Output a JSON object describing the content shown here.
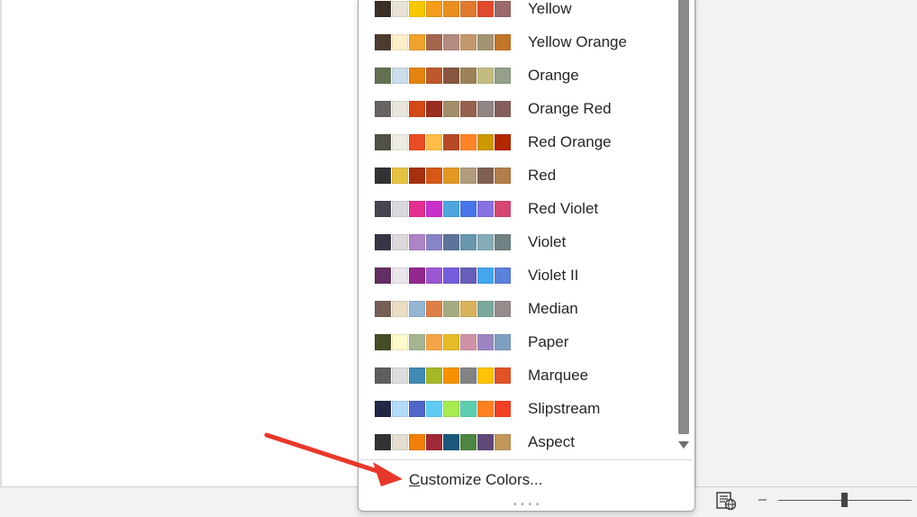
{
  "themes": [
    {
      "name": "Yellow",
      "colors": [
        "#3b2f28",
        "#e8e2d6",
        "#f7c700",
        "#f59c1a",
        "#ea8e20",
        "#e07a2e",
        "#e04a2e",
        "#9a6a6a"
      ]
    },
    {
      "name": "Yellow Orange",
      "colors": [
        "#4e3b30",
        "#fbeec9",
        "#f0a22e",
        "#a5644e",
        "#b58b80",
        "#c3986d",
        "#a19574",
        "#c17529"
      ]
    },
    {
      "name": "Orange",
      "colors": [
        "#637052",
        "#ccddea",
        "#e48312",
        "#bd582c",
        "#865640",
        "#9b8357",
        "#c2bc80",
        "#94a088"
      ]
    },
    {
      "name": "Orange Red",
      "colors": [
        "#696464",
        "#e9e5dc",
        "#d34817",
        "#9b2d1f",
        "#a28e6a",
        "#956251",
        "#918485",
        "#855d5d"
      ]
    },
    {
      "name": "Red Orange",
      "colors": [
        "#505046",
        "#eeece1",
        "#e84c22",
        "#ffbd47",
        "#b64926",
        "#ff8427",
        "#cc9900",
        "#b22600"
      ]
    },
    {
      "name": "Red",
      "colors": [
        "#323232",
        "#e5c243",
        "#a5300f",
        "#d55816",
        "#e19825",
        "#b19c7d",
        "#7f5f52",
        "#b27d49"
      ]
    },
    {
      "name": "Red Violet",
      "colors": [
        "#454551",
        "#d8d9dc",
        "#e32d91",
        "#c830cc",
        "#4ea6dc",
        "#4775e7",
        "#8971e1",
        "#d54773"
      ]
    },
    {
      "name": "Violet",
      "colors": [
        "#373545",
        "#dcd8dc",
        "#ad84c6",
        "#8784c7",
        "#5d739a",
        "#6997af",
        "#84acb6",
        "#6f8183"
      ]
    },
    {
      "name": "Violet II",
      "colors": [
        "#632e62",
        "#eae5eb",
        "#92278f",
        "#9b57d3",
        "#755dd9",
        "#665eb8",
        "#45a5ed",
        "#5982db"
      ]
    },
    {
      "name": "Median",
      "colors": [
        "#775f55",
        "#ebddc3",
        "#94b6d2",
        "#dd8047",
        "#a5ab81",
        "#d8b25c",
        "#7ba79d",
        "#968c8c"
      ]
    },
    {
      "name": "Paper",
      "colors": [
        "#444d26",
        "#fefac9",
        "#a5b592",
        "#f3a447",
        "#e7bc29",
        "#d092a7",
        "#9c85c0",
        "#809ec2"
      ]
    },
    {
      "name": "Marquee",
      "colors": [
        "#5e5e5e",
        "#dddddd",
        "#418ab3",
        "#a6b727",
        "#f69200",
        "#838383",
        "#fec306",
        "#df5327"
      ]
    },
    {
      "name": "Slipstream",
      "colors": [
        "#212745",
        "#b4dcfa",
        "#4e67c8",
        "#5eccf3",
        "#a7ea52",
        "#5dceaf",
        "#ff8021",
        "#f14124"
      ]
    },
    {
      "name": "Aspect",
      "colors": [
        "#323232",
        "#e3ded1",
        "#f07f09",
        "#9f2936",
        "#1b587c",
        "#4e8542",
        "#604878",
        "#c19859"
      ]
    }
  ],
  "footer": {
    "customize_prefix": "C",
    "customize_rest": "ustomize Colors..."
  },
  "annotation_color": "#e8382b",
  "icons": {
    "status_view": "web-layout-icon",
    "scroll_down": "triangle-down-icon",
    "zoom_out": "minus-icon"
  },
  "status": {
    "zoom_minus": "–"
  }
}
